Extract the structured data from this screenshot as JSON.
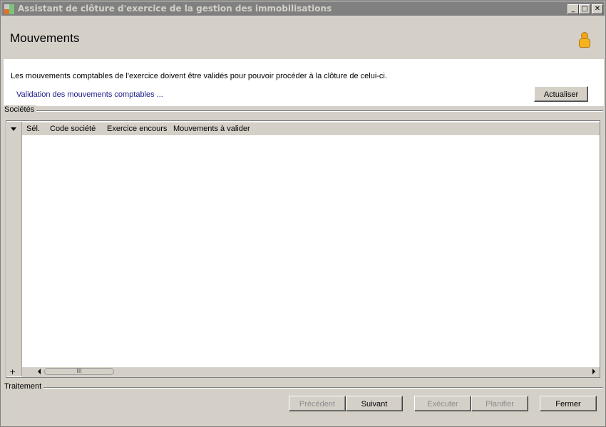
{
  "window": {
    "title": "Assistant de clôture d'exercice de la gestion des immobilisations",
    "controls": {
      "minimize": "_",
      "maximize": "□",
      "close": "✕"
    }
  },
  "header": {
    "title": "Mouvements",
    "icon": "user-icon"
  },
  "content": {
    "info_text": "Les mouvements comptables de l'exercice doivent être validés pour pouvoir procéder à la clôture de celui-ci.",
    "validation_link": "Validation des mouvements comptables ...",
    "refresh_button": "Actualiser"
  },
  "societes": {
    "group_label": "Sociétés",
    "columns": [
      "Sél.",
      "Code société",
      "Exercice encours",
      "Mouvements à valider"
    ],
    "rows": [],
    "add_symbol": "+",
    "scroll_thumb": "III"
  },
  "traitement": {
    "group_label": "Traitement",
    "buttons": {
      "previous": "Précédent",
      "next": "Suivant",
      "execute": "Exécuter",
      "schedule": "Planifier",
      "close": "Fermer"
    }
  },
  "colors": {
    "background": "#d4d0c8",
    "titlebar": "#808080",
    "link": "#1a1a8a",
    "disabled_text": "#8c8c8c"
  }
}
